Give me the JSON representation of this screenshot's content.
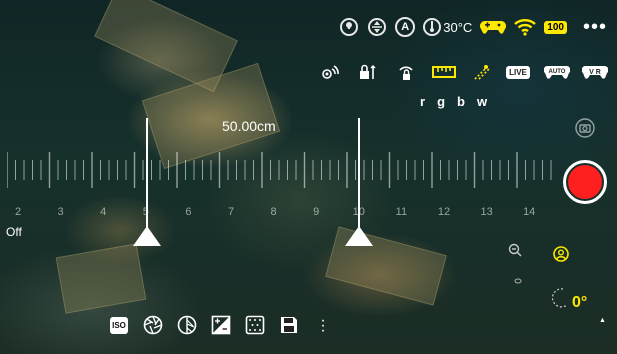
{
  "status_bar": {
    "temperature": "30°C",
    "battery": "100",
    "auto_badge": "A"
  },
  "toolbar": {
    "ruler_chip": "▀▀▀",
    "live_chip": "LIVE",
    "auto_chip": "AUTO",
    "vr_chip": "V R",
    "color_channels": [
      "r",
      "g",
      "b",
      "w"
    ]
  },
  "measurement": {
    "distance": "50.00cm",
    "ruler_labels": [
      "2",
      "3",
      "4",
      "5",
      "6",
      "7",
      "8",
      "9",
      "10",
      "11",
      "12",
      "13",
      "14"
    ],
    "off_label": "Off"
  },
  "heading": {
    "degrees": "0°"
  },
  "bottom_toolbar": {
    "iso_label": "ISO"
  },
  "colors": {
    "accent_yellow": "#ffe800",
    "record_red": "#ff1f1f"
  }
}
